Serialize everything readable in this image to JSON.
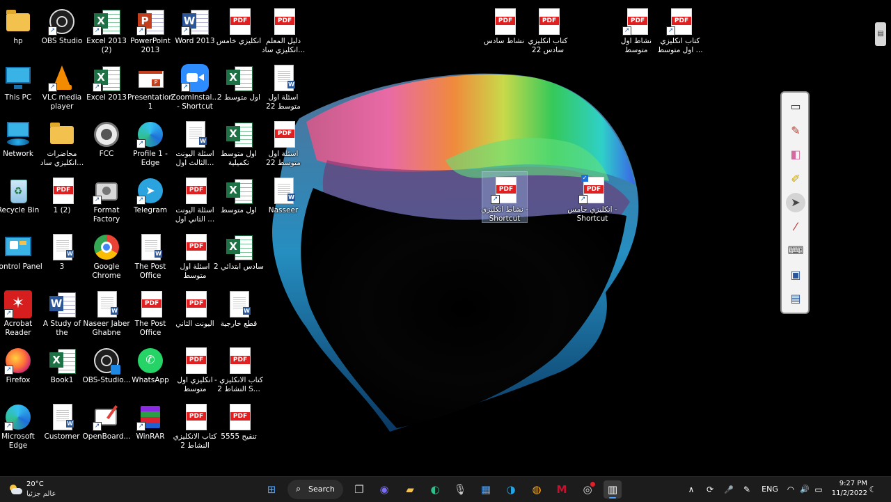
{
  "desktop": {
    "icons": [
      {
        "label": "hp",
        "type": "folder-user"
      },
      {
        "label": "OBS Studio",
        "type": "obs"
      },
      {
        "label": "Excel 2013 (2)",
        "type": "excel"
      },
      {
        "label": "PowerPoint 2013",
        "type": "powerpoint"
      },
      {
        "label": "Word 2013",
        "type": "word"
      },
      {
        "label": "انكليزي خامس",
        "type": "pdf"
      },
      {
        "label": "دليل المعلم انكليزي ساد...",
        "type": "pdf"
      },
      {
        "label": "This PC",
        "type": "this-pc"
      },
      {
        "label": "VLC media player",
        "type": "vlc"
      },
      {
        "label": "Excel 2013",
        "type": "excel"
      },
      {
        "label": "Presentation1",
        "type": "presentation"
      },
      {
        "label": "ZoomInstal... - Shortcut",
        "type": "zoom"
      },
      {
        "label": "اول متوسط 2",
        "type": "xls-file"
      },
      {
        "label": "اسئلة اول متوسط 22",
        "type": "doc-file"
      },
      {
        "label": "Network",
        "type": "network"
      },
      {
        "label": "محاضرات انكليزي ساد...",
        "type": "folder"
      },
      {
        "label": "FCC",
        "type": "fcc"
      },
      {
        "label": "Profile 1 - Edge",
        "type": "edge"
      },
      {
        "label": "اسئلة اليونت الثالث اول...",
        "type": "doc-file"
      },
      {
        "label": "اول متوسط تكميلية",
        "type": "xls-file"
      },
      {
        "label": "اسئلة اول متوسط 22",
        "type": "pdf"
      },
      {
        "label": "Recycle Bin",
        "type": "recycle"
      },
      {
        "label": "1 (2)",
        "type": "pdf"
      },
      {
        "label": "Format Factory",
        "type": "format-factory"
      },
      {
        "label": "Telegram",
        "type": "telegram"
      },
      {
        "label": "اسئلة اليونت الثاني اول ...",
        "type": "pdf"
      },
      {
        "label": "اول متوسط",
        "type": "xls-file"
      },
      {
        "label": "Nasseer",
        "type": "doc-file"
      },
      {
        "label": "Control Panel",
        "type": "control-panel"
      },
      {
        "label": "3",
        "type": "doc-file"
      },
      {
        "label": "Google Chrome",
        "type": "chrome"
      },
      {
        "label": "The Post Office",
        "type": "doc-file"
      },
      {
        "label": "اسئلة اول متوسط",
        "type": "pdf"
      },
      {
        "label": "سادس ابتدائي 2",
        "type": "xls-file"
      },
      {
        "label": "Acrobat Reader",
        "type": "acrobat"
      },
      {
        "label": "A Study of the Traumat...",
        "type": "doc-file"
      },
      {
        "label": "Naseer Jaber Ghabne",
        "type": "doc-file"
      },
      {
        "label": "The Post Office",
        "type": "pdf"
      },
      {
        "label": "اليونت الثاني",
        "type": "pdf"
      },
      {
        "label": "قطع خارجية",
        "type": "doc-file"
      },
      {
        "label": "Firefox",
        "type": "firefox"
      },
      {
        "label": "Book1",
        "type": "xls-file"
      },
      {
        "label": "OBS-Studio...",
        "type": "obs"
      },
      {
        "label": "WhatsApp",
        "type": "whatsapp"
      },
      {
        "label": "انكليزي اول متوسط",
        "type": "pdf"
      },
      {
        "label": "كتاب الانكليزي - النشاط 2 S...",
        "type": "pdf"
      },
      {
        "label": "Microsoft Edge",
        "type": "edge"
      },
      {
        "label": "Customer",
        "type": "doc-file"
      },
      {
        "label": "OpenBoard...",
        "type": "openboard"
      },
      {
        "label": "WinRAR",
        "type": "winrar"
      },
      {
        "label": "كتاب الانكليزي النشاط 2",
        "type": "pdf"
      },
      {
        "label": "تنقيح 5555",
        "type": "pdf"
      },
      {
        "label": "نشاط سادس",
        "type": "pdf"
      },
      {
        "label": "كتاب انكليزي سادس 22",
        "type": "pdf"
      },
      {
        "label": "نشاط اول متوسط",
        "type": "pdf"
      },
      {
        "label": "كتاب انكليزي اول متوسط ...",
        "type": "pdf"
      },
      {
        "label": "نشاط انكليزي - Shortcut",
        "type": "pdf"
      },
      {
        "label": "انكليزي خامس - Shortcut",
        "type": "pdf"
      }
    ]
  },
  "ink_toolbar": {
    "tools": [
      {
        "name": "whiteboard",
        "glyph": "▭"
      },
      {
        "name": "pen",
        "glyph": "✎"
      },
      {
        "name": "eraser",
        "glyph": "◧"
      },
      {
        "name": "highlighter",
        "glyph": "✐"
      },
      {
        "name": "pointer",
        "glyph": "➤"
      },
      {
        "name": "laser",
        "glyph": "⁄"
      },
      {
        "name": "keyboard",
        "glyph": "⌨"
      },
      {
        "name": "screen-capture",
        "glyph": "▣"
      },
      {
        "name": "show-desktop",
        "glyph": "▤"
      }
    ],
    "side_tab_glyph": "▤"
  },
  "taskbar": {
    "weather": {
      "temp": "20°C",
      "condition": "عالم جزئيا"
    },
    "search_label": "Search",
    "apps": [
      {
        "name": "start",
        "glyph": "⊞",
        "color": "#4aa3ff"
      },
      {
        "name": "task-view",
        "glyph": "❐",
        "color": "#cfcfcf"
      },
      {
        "name": "chat",
        "glyph": "◉",
        "color": "#7b6cf6"
      },
      {
        "name": "file-explorer",
        "glyph": "▰",
        "color": "#f2c14e"
      },
      {
        "name": "edge",
        "glyph": "◐",
        "color": "#2fbf8a"
      },
      {
        "name": "microphone",
        "glyph": "🎙",
        "color": "#cccccc"
      },
      {
        "name": "store",
        "glyph": "▦",
        "color": "#4aa3ff"
      },
      {
        "name": "edge-dev",
        "glyph": "◑",
        "color": "#22a6e8"
      },
      {
        "name": "paint",
        "glyph": "◍",
        "color": "#f5a623"
      },
      {
        "name": "mcafee",
        "glyph": "M",
        "color": "#c8102e"
      },
      {
        "name": "obs",
        "glyph": "◎",
        "color": "#dddddd"
      },
      {
        "name": "openboard",
        "glyph": "▥",
        "color": "#ffffff"
      }
    ],
    "tray": {
      "chevron": "∧",
      "sync": "⟳",
      "mic": "🎤",
      "pen": "✎",
      "language": "ENG",
      "wifi": "◠",
      "volume": "🔊",
      "battery": "▭",
      "time": "9:27 PM",
      "date": "11/2/2022",
      "notifications": "☾"
    }
  }
}
